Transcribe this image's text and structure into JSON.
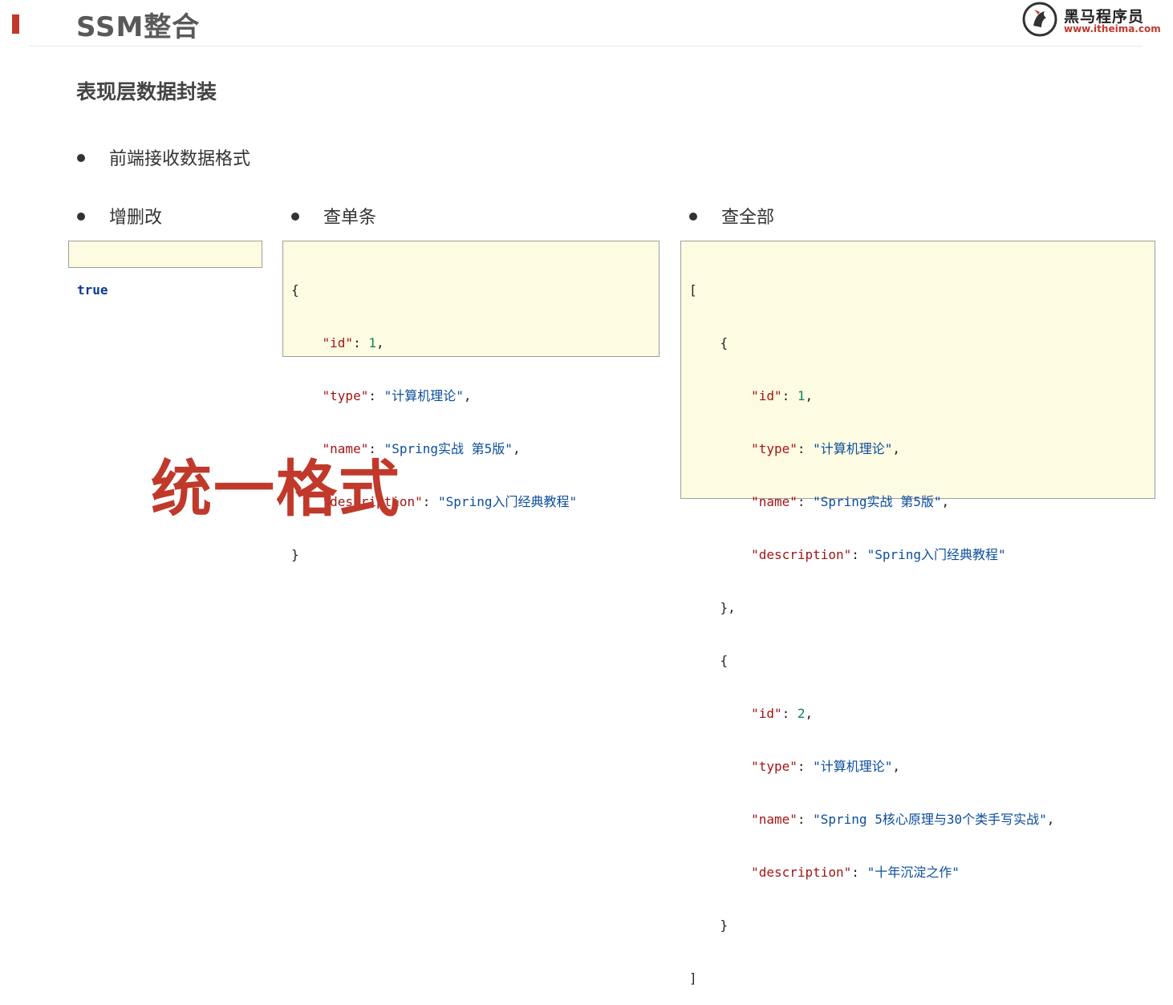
{
  "header": {
    "title": "SSM整合",
    "logo_name": "黑马程序员",
    "logo_url": "www.itheima.com",
    "accent_color": "#c0392b"
  },
  "subtitle": "表现层数据封装",
  "bullets": {
    "main": "前端接收数据格式",
    "col1": "增删改",
    "col2": "查单条",
    "col3": "查全部"
  },
  "boolean_example": "true",
  "single_item": {
    "open": "{",
    "id_key": "\"id\"",
    "id_val": "1",
    "type_key": "\"type\"",
    "type_val": "\"计算机理论\"",
    "name_key": "\"name\"",
    "name_val": "\"Spring实战 第5版\"",
    "desc_key": "\"description\"",
    "desc_val": "\"Spring入门经典教程\"",
    "close": "}"
  },
  "list_items": {
    "open": "[",
    "close": "]",
    "items": [
      {
        "open": "{",
        "id_key": "\"id\"",
        "id_val": "1",
        "type_key": "\"type\"",
        "type_val": "\"计算机理论\"",
        "name_key": "\"name\"",
        "name_val": "\"Spring实战 第5版\"",
        "desc_key": "\"description\"",
        "desc_val": "\"Spring入门经典教程\"",
        "close": "},"
      },
      {
        "open": "{",
        "id_key": "\"id\"",
        "id_val": "2",
        "type_key": "\"type\"",
        "type_val": "\"计算机理论\"",
        "name_key": "\"name\"",
        "name_val": "\"Spring 5核心原理与30个类手写实战\"",
        "desc_key": "\"description\"",
        "desc_val": "\"十年沉淀之作\"",
        "close": "}"
      }
    ]
  },
  "callout": "统一格式"
}
